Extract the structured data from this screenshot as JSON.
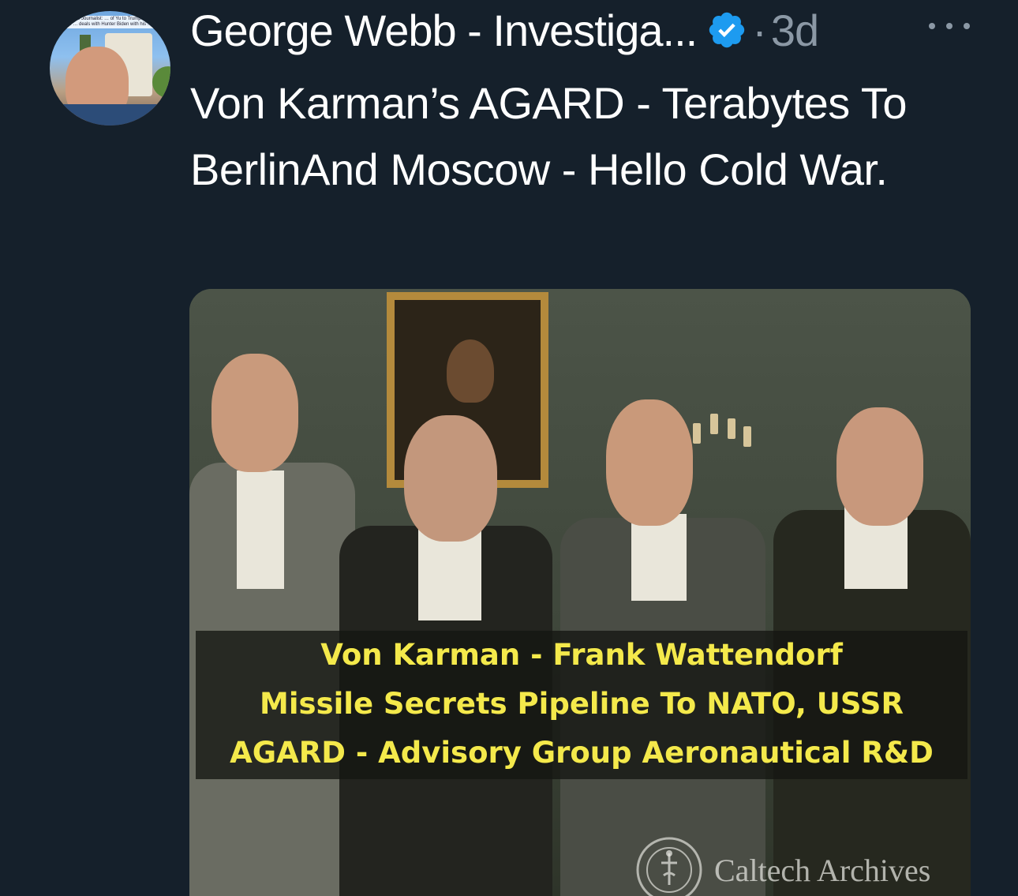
{
  "tweet": {
    "author_name": "George Webb - Investiga...",
    "separator": "·",
    "timestamp": "3d",
    "body_text": "Von Karman’s AGARD - Terabytes To BerlinAnd Moscow - Hello Cold War.",
    "avatar_ticker": "igative Journalist: … of Yu to Trump? Didn't he … deals with Hunter Biden with his …"
  },
  "media": {
    "caption_lines": [
      "Von Karman - Frank Wattendorf",
      "Missile Secrets Pipeline To NATO, USSR",
      "AGARD - Advisory Group Aeronautical R&D"
    ],
    "watermark_text": "Caltech Archives"
  },
  "icons": {
    "verified": "verified-badge-icon",
    "more": "more-horizontal-icon"
  },
  "colors": {
    "background": "#15202b",
    "secondary_text": "#8b98a5",
    "verified": "#1d9bf0",
    "caption_text": "#f4e94b"
  }
}
